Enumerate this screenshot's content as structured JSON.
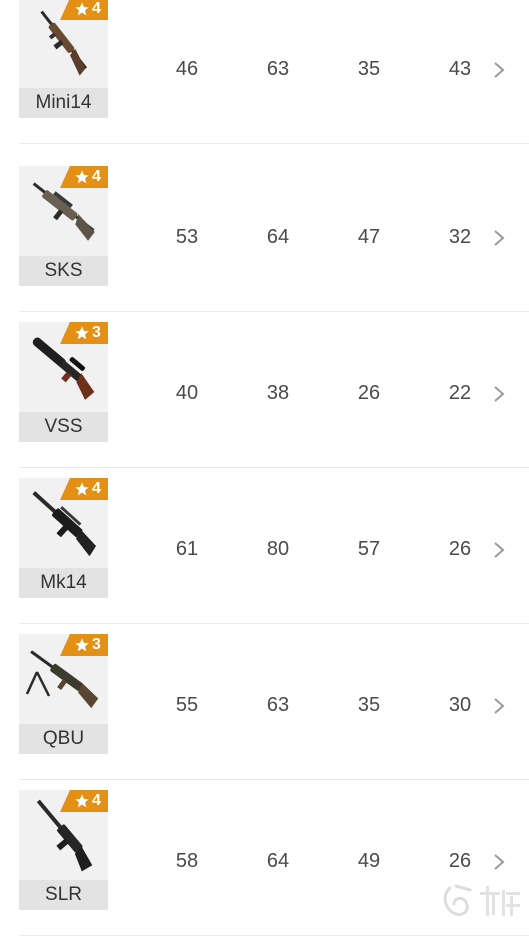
{
  "colors": {
    "badge": "#e39014",
    "text": "#4a4a4a",
    "divider": "#e9e9e9",
    "name_bar": "#e3e3e3"
  },
  "weapons": [
    {
      "name": "Mini14",
      "stars": "4",
      "stats": [
        "46",
        "63",
        "35",
        "43"
      ],
      "icon": "mini14-rifle-icon"
    },
    {
      "name": "SKS",
      "stars": "4",
      "stats": [
        "53",
        "64",
        "47",
        "32"
      ],
      "icon": "sks-rifle-icon"
    },
    {
      "name": "VSS",
      "stars": "3",
      "stats": [
        "40",
        "38",
        "26",
        "22"
      ],
      "icon": "vss-rifle-icon"
    },
    {
      "name": "Mk14",
      "stars": "4",
      "stats": [
        "61",
        "80",
        "57",
        "26"
      ],
      "icon": "mk14-rifle-icon"
    },
    {
      "name": "QBU",
      "stars": "3",
      "stats": [
        "55",
        "63",
        "35",
        "30"
      ],
      "icon": "qbu-rifle-icon"
    },
    {
      "name": "SLR",
      "stars": "4",
      "stats": [
        "58",
        "64",
        "49",
        "26"
      ],
      "icon": "slr-rifle-icon"
    }
  ],
  "watermark": {
    "icon": "jiuyou-logo-icon",
    "text": "九游"
  }
}
